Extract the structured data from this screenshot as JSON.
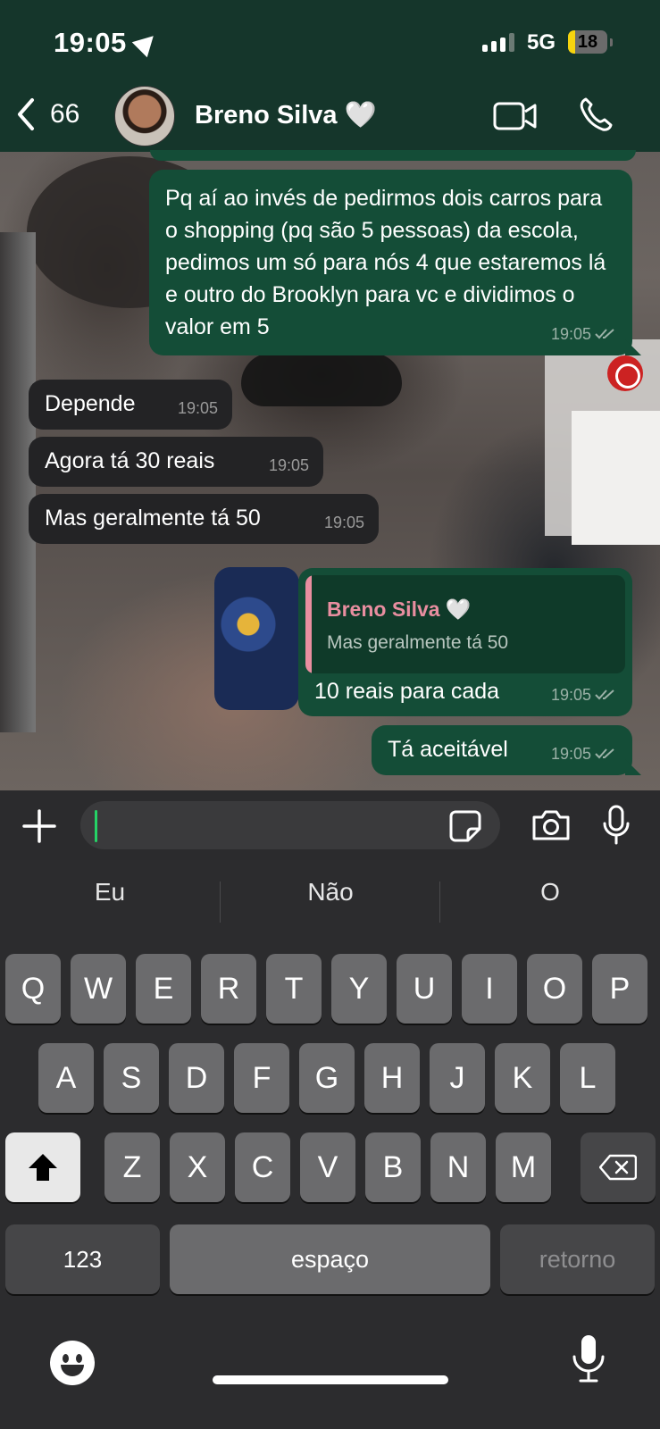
{
  "status": {
    "time": "19:05",
    "network": "5G",
    "battery": "18",
    "battery_level": 0.18
  },
  "header": {
    "back_count": "66",
    "contact_name": "Breno Silva 🤍"
  },
  "messages": {
    "m1": {
      "text": "Pq aí ao invés de pedirmos dois carros para o shopping (pq são 5 pessoas) da escola, pedimos um só para nós 4 que estaremos lá e outro do Brooklyn para vc e dividimos o valor em 5",
      "time": "19:05"
    },
    "m2": {
      "text": "Depende",
      "time": "19:05"
    },
    "m3": {
      "text": "Agora tá 30 reais",
      "time": "19:05"
    },
    "m4": {
      "text": "Mas geralmente tá 50",
      "time": "19:05"
    },
    "m5": {
      "reply_name": "Breno Silva 🤍",
      "reply_text": "Mas geralmente tá 50",
      "text": "10 reais para cada",
      "time": "19:05"
    },
    "m6": {
      "text": "Tá aceitável",
      "time": "19:05"
    }
  },
  "suggestions": [
    "Eu",
    "Não",
    "O"
  ],
  "keys": {
    "row1": [
      "Q",
      "W",
      "E",
      "R",
      "T",
      "Y",
      "U",
      "I",
      "O",
      "P"
    ],
    "row2": [
      "A",
      "S",
      "D",
      "F",
      "G",
      "H",
      "J",
      "K",
      "L"
    ],
    "row3": [
      "Z",
      "X",
      "C",
      "V",
      "B",
      "N",
      "M"
    ],
    "numbers": "123",
    "space": "espaço",
    "return": "retorno"
  },
  "colors": {
    "header_bg": "#15362b",
    "outgoing_bubble": "#144d37",
    "incoming_bubble": "#232325",
    "reply_accent": "#e98ea0",
    "caret": "#25d366"
  }
}
